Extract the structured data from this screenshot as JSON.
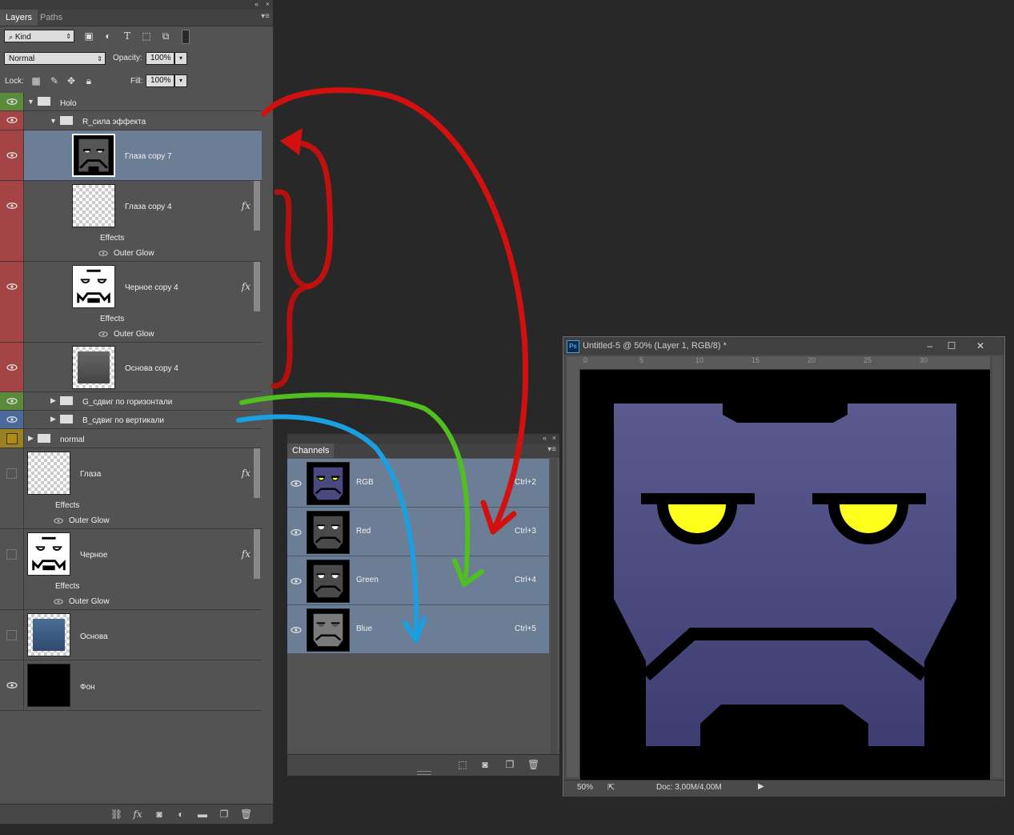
{
  "layers_panel": {
    "tabs": [
      "Layers",
      "Paths"
    ],
    "filter_kind": "Kind",
    "blend_mode": "Normal",
    "opacity_label": "Opacity:",
    "opacity_value": "100%",
    "lock_label": "Lock:",
    "fill_label": "Fill:",
    "fill_value": "100%",
    "layers": [
      {
        "name": "Holo",
        "kind": "group",
        "expanded": true,
        "color": "#5a8a3a"
      },
      {
        "name": "R_сила эффекта",
        "kind": "group",
        "expanded": true,
        "color": "#a54444"
      },
      {
        "name": "Глаза copy 7",
        "kind": "layer",
        "selected": true,
        "color": "#a54444"
      },
      {
        "name": "Глаза copy 4",
        "kind": "layer",
        "fx": true,
        "effects_label": "Effects",
        "effect": "Outer Glow",
        "color": "#a54444"
      },
      {
        "name": "Черное copy 4",
        "kind": "layer",
        "fx": true,
        "effects_label": "Effects",
        "effect": "Outer Glow",
        "color": "#a54444"
      },
      {
        "name": "Основа copy 4",
        "kind": "layer",
        "color": "#a54444"
      },
      {
        "name": "G_сдвиг по горизонтали",
        "kind": "group",
        "expanded": false,
        "color": "#5a8a3a"
      },
      {
        "name": "B_сдвиг по вертикали",
        "kind": "group",
        "expanded": false,
        "color": "#4a6a9a"
      },
      {
        "name": "normal",
        "kind": "group",
        "expanded": false,
        "color": "#9a8020"
      },
      {
        "name": "Глаза",
        "kind": "layer",
        "fx": true,
        "effects_label": "Effects",
        "effect": "Outer Glow",
        "visible": false
      },
      {
        "name": "Черное",
        "kind": "layer",
        "fx": true,
        "effects_label": "Effects",
        "effect": "Outer Glow",
        "visible": false
      },
      {
        "name": "Основа",
        "kind": "layer",
        "visible": false
      },
      {
        "name": "Фон",
        "kind": "layer",
        "visible": true
      }
    ]
  },
  "channels_panel": {
    "tab": "Channels",
    "channels": [
      {
        "name": "RGB",
        "shortcut": "Ctrl+2"
      },
      {
        "name": "Red",
        "shortcut": "Ctrl+3"
      },
      {
        "name": "Green",
        "shortcut": "Ctrl+4"
      },
      {
        "name": "Blue",
        "shortcut": "Ctrl+5"
      }
    ]
  },
  "document": {
    "app_badge": "Ps",
    "title": "Untitled-5 @ 50% (Layer 1, RGB/8) *",
    "ruler_ticks": [
      "0",
      "5",
      "10",
      "15",
      "20",
      "25",
      "30"
    ],
    "zoom": "50%",
    "doc_info": "Doc: 3,00M/4,00M",
    "canvas_colors": {
      "bg": "#000000",
      "face": "#4a4a80",
      "eyes": "#ffff1e"
    }
  },
  "annotation_colors": {
    "red": "#d21010",
    "green": "#50c020",
    "blue": "#1aa0e0"
  }
}
